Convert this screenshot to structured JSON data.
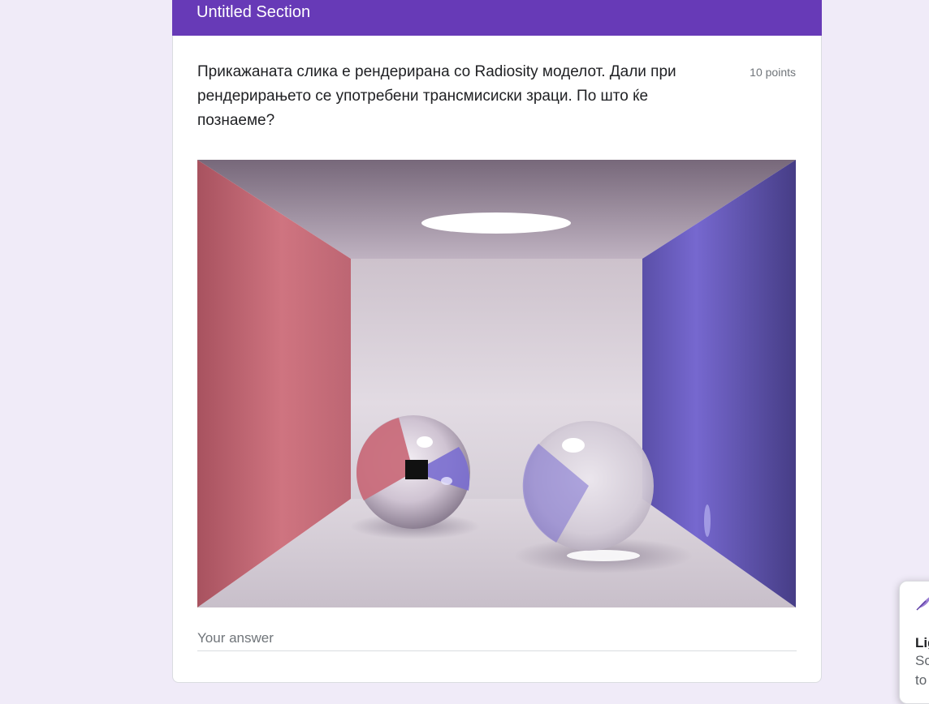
{
  "section": {
    "title": "Untitled Section"
  },
  "question": {
    "text": "Прикажаната слика е рендерирана со Radiosity моделот. Дали при рендерирањето се употребени трансмисиски зраци. По што ќе познаеме?",
    "points": "10 points",
    "image_alt": "Rendered Cornell box with a red wall, a blue wall, a mirror sphere and a glass sphere",
    "answer_placeholder": "Your answer"
  },
  "floating_panel": {
    "icon": "feather-icon",
    "title": "Lig",
    "line1": "Sc",
    "line2": "to"
  },
  "colors": {
    "header": "#673ab7",
    "background": "#f0ebf8",
    "left_wall": "#c56a78",
    "right_wall": "#6f63c4"
  }
}
